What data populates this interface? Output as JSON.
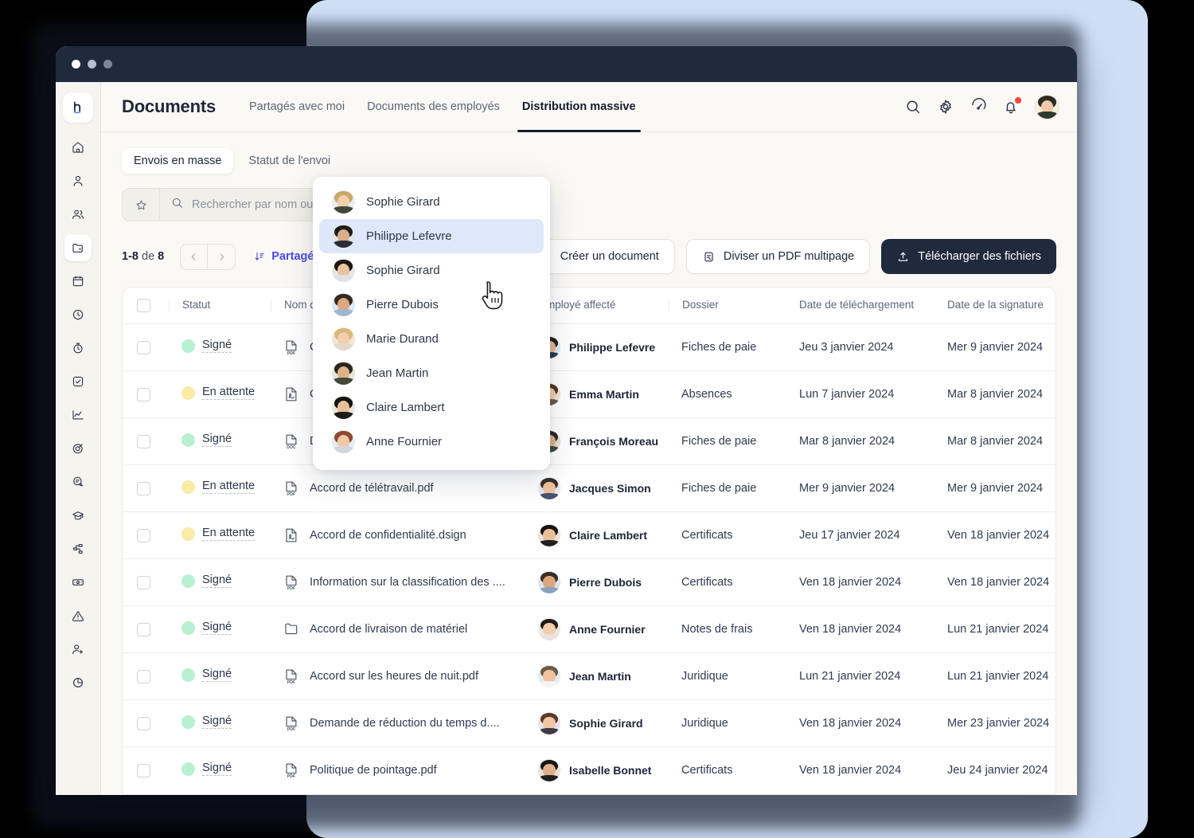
{
  "window": {
    "traffic_lights": [
      "close",
      "minimize",
      "maximize"
    ]
  },
  "header": {
    "app_title": "Documents",
    "tabs": [
      {
        "label": "Partagés avec moi",
        "active": false
      },
      {
        "label": "Documents des employés",
        "active": false
      },
      {
        "label": "Distribution massive",
        "active": true
      }
    ],
    "icons": [
      "search-icon",
      "gear-icon",
      "speedometer-icon",
      "bell-icon"
    ],
    "notification_dot": true
  },
  "sidebar": {
    "logo": "h",
    "items": [
      {
        "name": "home-icon"
      },
      {
        "name": "user-icon"
      },
      {
        "name": "people-icon"
      },
      {
        "name": "folder-documents-icon",
        "active": true
      },
      {
        "name": "calendar-icon"
      },
      {
        "name": "clock-icon"
      },
      {
        "name": "timer-icon"
      },
      {
        "name": "task-check-icon"
      },
      {
        "name": "analytics-icon"
      },
      {
        "name": "target-icon"
      },
      {
        "name": "chat-icon"
      },
      {
        "name": "graduation-cap-icon"
      },
      {
        "name": "workflow-icon"
      },
      {
        "name": "money-icon"
      },
      {
        "name": "alert-icon"
      },
      {
        "name": "user-add-icon"
      },
      {
        "name": "pie-chart-icon"
      }
    ]
  },
  "segment": {
    "items": [
      {
        "label": "Envois en masse",
        "active": true
      },
      {
        "label": "Statut de l'envoi",
        "active": false
      }
    ]
  },
  "search": {
    "placeholder": "Rechercher par nom ou par type de filtre...",
    "value": "",
    "clear_label": "✕"
  },
  "toolbar": {
    "pagination_range": "1-8",
    "pagination_of": "de",
    "pagination_total": "8",
    "sort_label": "Partagé",
    "buttons": [
      {
        "label": "Créer un document",
        "style": "light",
        "icon": "file-plus-icon"
      },
      {
        "label": "Diviser un PDF multipage",
        "style": "light",
        "icon": "split-pdf-icon"
      },
      {
        "label": "Télécharger des fichiers",
        "style": "dark",
        "icon": "upload-icon"
      }
    ]
  },
  "table": {
    "columns": [
      "Statut",
      "Nom du fichier",
      "Employé affecté",
      "Dossier",
      "Date de téléchargement",
      "Date de la signature"
    ],
    "rows": [
      {
        "status": "Signé",
        "status_color": "green",
        "file": "Contrat de travail.pdf",
        "file_type": "PDF",
        "employee": "Philippe Lefevre",
        "avatar": "a1",
        "folder": "Fiches de paie",
        "upload_date": "Jeu 3 janvier 2024",
        "sign_date": "Mer 9 janvier 2024"
      },
      {
        "status": "En attente",
        "status_color": "yellow",
        "file": "Convention de stage",
        "file_type": "SIGN",
        "employee": "Emma Martin",
        "avatar": "a2",
        "folder": "Absences",
        "upload_date": "Lun 7 janvier 2024",
        "sign_date": "Mar 8 janvier 2024"
      },
      {
        "status": "Signé",
        "status_color": "green",
        "file": "Demande d'absence",
        "file_type": "DOC",
        "employee": "François Moreau",
        "avatar": "a3",
        "folder": "Fiches de paie",
        "upload_date": "Mar 8 janvier 2024",
        "sign_date": "Mar 8 janvier 2024"
      },
      {
        "status": "En attente",
        "status_color": "yellow",
        "file": "Accord de télétravail.pdf",
        "file_type": "PDF",
        "employee": "Jacques Simon",
        "avatar": "a4",
        "folder": "Fiches de paie",
        "upload_date": "Mer 9 janvier 2024",
        "sign_date": "Mer 9 janvier 2024"
      },
      {
        "status": "En attente",
        "status_color": "yellow",
        "file": "Accord de confidentialité.dsign",
        "file_type": "SIGN",
        "employee": "Claire Lambert",
        "avatar": "a5",
        "folder": "Certificats",
        "upload_date": "Jeu 17 janvier 2024",
        "sign_date": "Ven 18 janvier 2024"
      },
      {
        "status": "Signé",
        "status_color": "green",
        "file": "Information sur la classification des ....",
        "file_type": "PDF",
        "employee": "Pierre Dubois",
        "avatar": "a6",
        "folder": "Certificats",
        "upload_date": "Ven 18 janvier 2024",
        "sign_date": "Ven 18 janvier 2024"
      },
      {
        "status": "Signé",
        "status_color": "green",
        "file": "Accord de livraison de matériel",
        "file_type": "FOLDER",
        "employee": "Anne Fournier",
        "avatar": "a7",
        "folder": "Notes de frais",
        "upload_date": "Ven 18 janvier 2024",
        "sign_date": "Lun 21 janvier 2024"
      },
      {
        "status": "Signé",
        "status_color": "green",
        "file": "Accord sur les heures de nuit.pdf",
        "file_type": "PDF",
        "employee": "Jean Martin",
        "avatar": "a8",
        "folder": "Juridique",
        "upload_date": "Lun 21 janvier 2024",
        "sign_date": "Lun 21 janvier 2024"
      },
      {
        "status": "Signé",
        "status_color": "green",
        "file": "Demande de réduction du temps d....",
        "file_type": "PDF",
        "employee": "Sophie Girard",
        "avatar": "a9",
        "folder": "Juridique",
        "upload_date": "Ven 18 janvier 2024",
        "sign_date": "Mer 23 janvier 2024"
      },
      {
        "status": "Signé",
        "status_color": "green",
        "file": "Politique de pointage.pdf",
        "file_type": "PDF",
        "employee": "Isabelle Bonnet",
        "avatar": "a10",
        "folder": "Certificats",
        "upload_date": "Ven 18 janvier 2024",
        "sign_date": "Jeu 24 janvier 2024"
      }
    ]
  },
  "dropdown": {
    "items": [
      {
        "label": "Sophie Girard",
        "highlighted": false,
        "avatar": "d1"
      },
      {
        "label": "Philippe Lefevre",
        "highlighted": true,
        "avatar": "d2"
      },
      {
        "label": "Sophie Girard",
        "highlighted": false,
        "avatar": "d3"
      },
      {
        "label": "Pierre Dubois",
        "highlighted": false,
        "avatar": "d4"
      },
      {
        "label": "Marie Durand",
        "highlighted": false,
        "avatar": "d5"
      },
      {
        "label": "Jean Martin",
        "highlighted": false,
        "avatar": "d6"
      },
      {
        "label": "Claire Lambert",
        "highlighted": false,
        "avatar": "d7"
      },
      {
        "label": "Anne Fournier",
        "highlighted": false,
        "avatar": "d8"
      }
    ]
  },
  "colors": {
    "backdrop": "#cddef5",
    "window_chrome": "#1f2a3d",
    "app_bg": "#fbf9f5",
    "accent_link": "#4f46e5",
    "status_signed": "#b9f0d2",
    "status_pending": "#fbeaa8",
    "notification": "#f2453d"
  }
}
